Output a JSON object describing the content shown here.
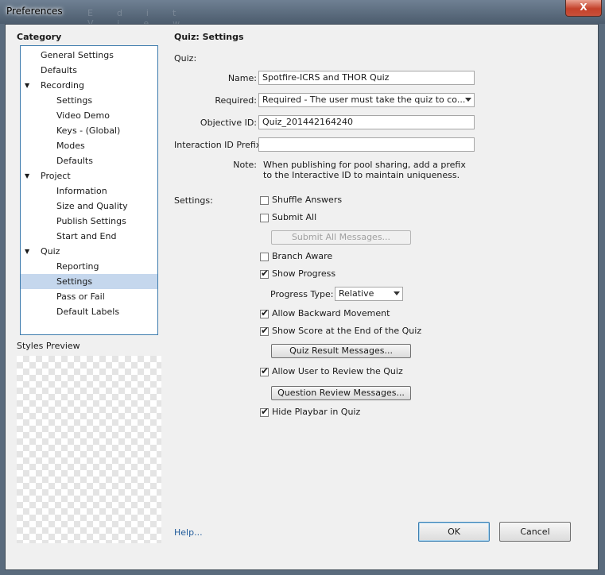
{
  "window": {
    "title": "Preferences",
    "menu_ghost": "Edit View Themes Window Help",
    "close_symbol": "X"
  },
  "category": {
    "heading": "Category",
    "items": [
      {
        "label": "General Settings",
        "level": 0,
        "expandable": false
      },
      {
        "label": "Defaults",
        "level": 0,
        "expandable": false
      },
      {
        "label": "Recording",
        "level": 0,
        "expandable": true
      },
      {
        "label": "Settings",
        "level": 1,
        "expandable": false
      },
      {
        "label": "Video Demo",
        "level": 1,
        "expandable": false
      },
      {
        "label": "Keys - (Global)",
        "level": 1,
        "expandable": false
      },
      {
        "label": "Modes",
        "level": 1,
        "expandable": false
      },
      {
        "label": "Defaults",
        "level": 1,
        "expandable": false
      },
      {
        "label": "Project",
        "level": 0,
        "expandable": true
      },
      {
        "label": "Information",
        "level": 1,
        "expandable": false
      },
      {
        "label": "Size and Quality",
        "level": 1,
        "expandable": false
      },
      {
        "label": "Publish Settings",
        "level": 1,
        "expandable": false
      },
      {
        "label": "Start and End",
        "level": 1,
        "expandable": false
      },
      {
        "label": "Quiz",
        "level": 0,
        "expandable": true
      },
      {
        "label": "Reporting",
        "level": 1,
        "expandable": false
      },
      {
        "label": "Settings",
        "level": 1,
        "expandable": false,
        "selected": true
      },
      {
        "label": "Pass or Fail",
        "level": 1,
        "expandable": false
      },
      {
        "label": "Default Labels",
        "level": 1,
        "expandable": false
      }
    ],
    "expand_glyph": "▼",
    "selection_color": "#c5d7ed"
  },
  "styles_preview": {
    "label": "Styles Preview"
  },
  "panel": {
    "title": "Quiz: Settings",
    "quiz_label": "Quiz:",
    "name_label": "Name:",
    "name_value": "Spotfire-ICRS and THOR Quiz",
    "required_label": "Required:",
    "required_value": "Required - The user must take the quiz to co...",
    "objective_label": "Objective ID:",
    "objective_value": "Quiz_201442164240",
    "interaction_label": "Interaction ID Prefix:",
    "interaction_value": "",
    "note_label": "Note:",
    "note_line1": "When publishing for pool sharing, add a prefix",
    "note_line2": "to the Interactive ID to maintain uniqueness.",
    "settings_label": "Settings:",
    "shuffle_answers": {
      "label": "Shuffle Answers",
      "checked": false
    },
    "submit_all": {
      "label": "Submit All",
      "checked": false
    },
    "submit_all_messages_btn": "Submit All Messages...",
    "branch_aware": {
      "label": "Branch Aware",
      "checked": false
    },
    "show_progress": {
      "label": "Show Progress",
      "checked": true
    },
    "progress_type_label": "Progress Type:",
    "progress_type_value": "Relative",
    "allow_backward": {
      "label": "Allow Backward Movement",
      "checked": true
    },
    "show_score": {
      "label": "Show Score at the End of the Quiz",
      "checked": true
    },
    "quiz_result_btn": "Quiz Result Messages...",
    "allow_review": {
      "label": "Allow User to Review the Quiz",
      "checked": true
    },
    "question_review_btn": "Question Review Messages...",
    "hide_playbar": {
      "label": "Hide Playbar in Quiz",
      "checked": true
    },
    "check_glyph": "✔"
  },
  "footer": {
    "help_link": "Help...",
    "ok_btn": "OK",
    "cancel_btn": "Cancel"
  }
}
